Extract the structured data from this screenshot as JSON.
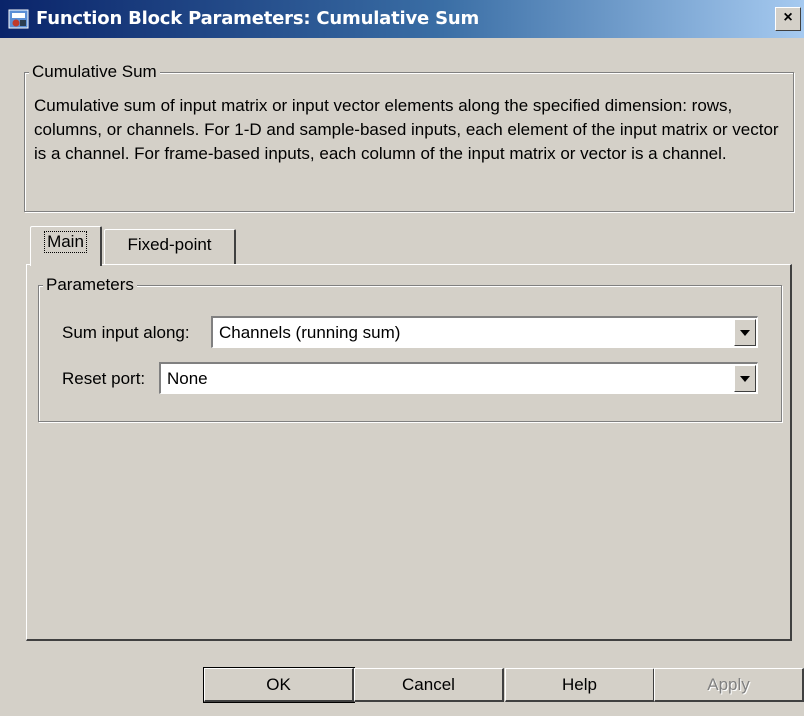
{
  "window": {
    "title": "Function Block Parameters: Cumulative Sum",
    "close_glyph": "×",
    "icon": "simulink-block-icon"
  },
  "block_group": {
    "legend": "Cumulative Sum",
    "description": "Cumulative sum of input matrix or input vector elements along the specified dimension: rows, columns, or channels.  For 1-D and sample-based inputs, each element of the input matrix or vector is a channel.  For frame-based inputs, each column of the input matrix or vector is a channel."
  },
  "tabs": [
    {
      "label": "Main",
      "active": true
    },
    {
      "label": "Fixed-point",
      "active": false
    }
  ],
  "parameters": {
    "legend": "Parameters",
    "sum_input_along": {
      "label": "Sum input along:",
      "value": "Channels (running sum)"
    },
    "reset_port": {
      "label": "Reset port:",
      "value": "None"
    }
  },
  "buttons": {
    "ok": "OK",
    "cancel": "Cancel",
    "help": "Help",
    "apply": "Apply"
  }
}
